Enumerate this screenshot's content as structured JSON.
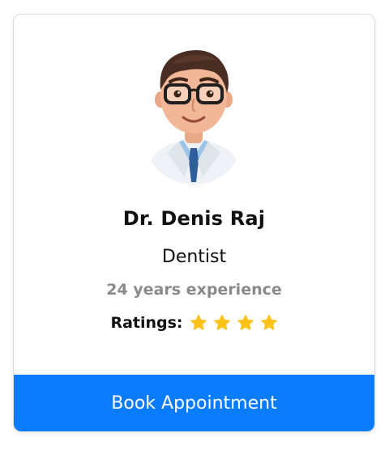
{
  "doctor": {
    "name": "Dr. Denis Raj",
    "specialty": "Dentist",
    "experience": "24 years experience",
    "ratings_label": "Ratings:",
    "rating_stars": 4,
    "avatar": "doctor-cartoon-avatar"
  },
  "actions": {
    "book_label": "Book Appointment"
  },
  "colors": {
    "accent": "#0a7cff",
    "star": "#ffc21a",
    "muted_text": "#8a8a8a"
  }
}
